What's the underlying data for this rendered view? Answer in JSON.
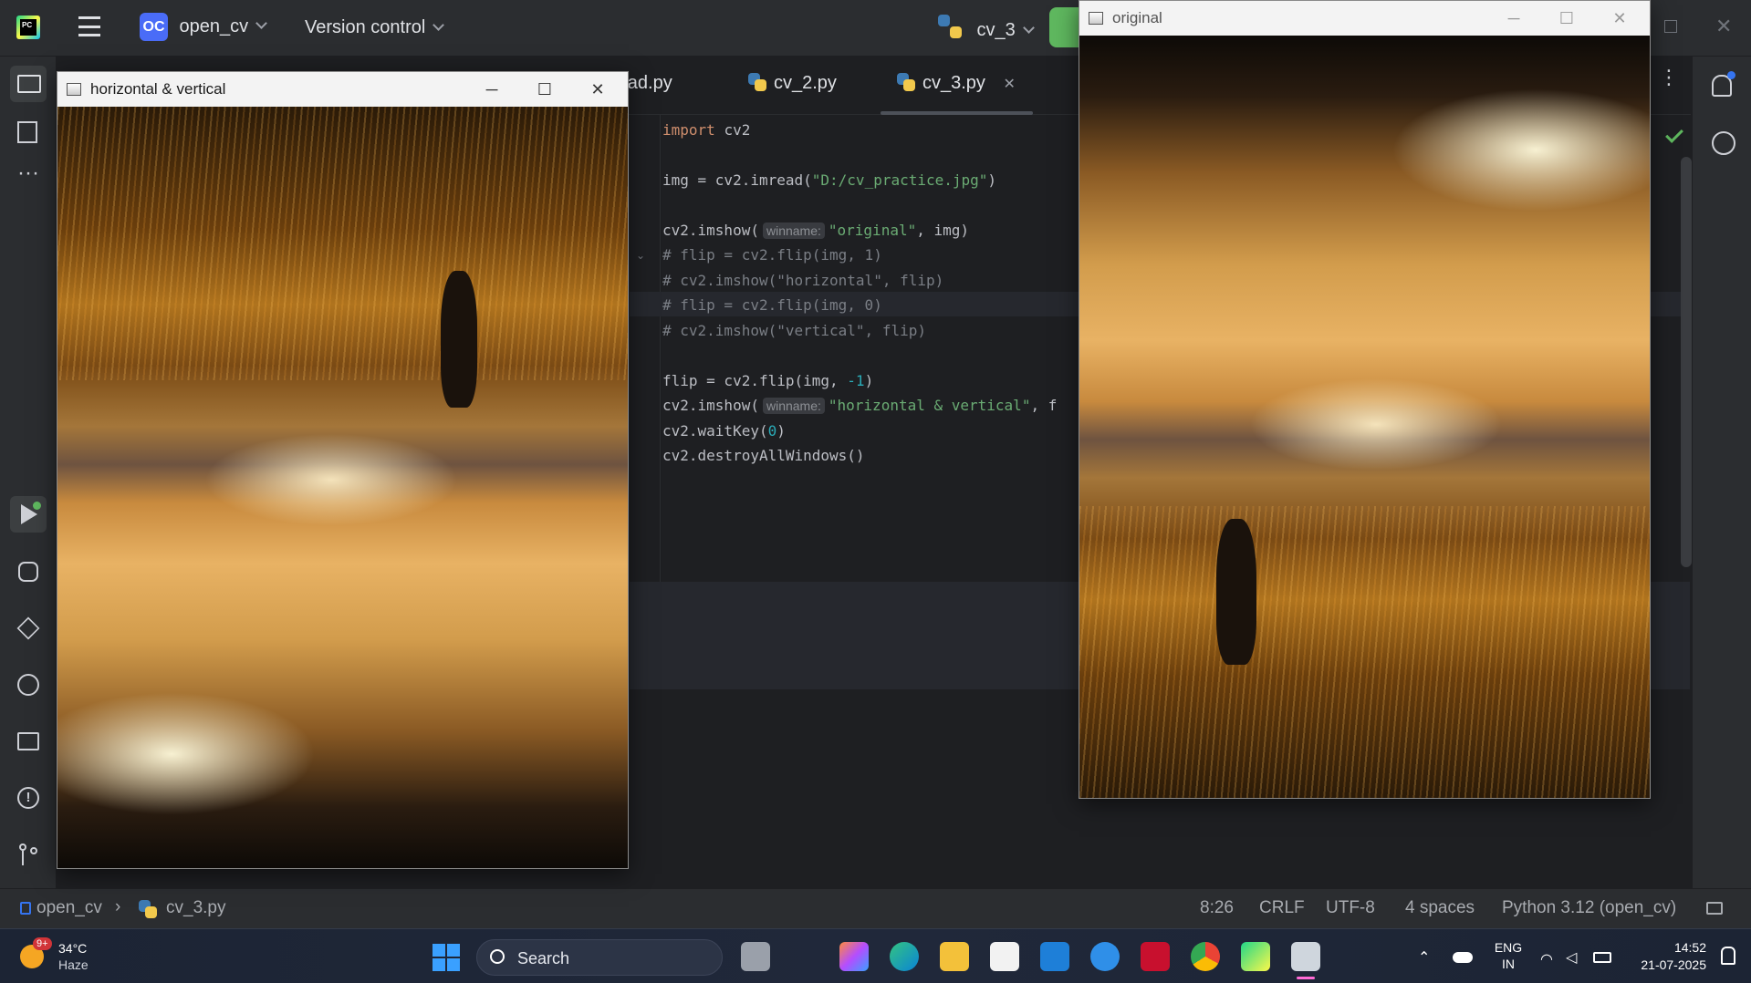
{
  "ide": {
    "project_badge": "OC",
    "project_name": "open_cv",
    "vcs": "Version control",
    "run_config": "cv_3",
    "tabs": [
      {
        "label": "read.py"
      },
      {
        "label": "cv_2.py"
      },
      {
        "label": "cv_3.py"
      }
    ],
    "code_lines": [
      {
        "a": "import cv2"
      },
      {
        "a": "img = cv2.imread(",
        "s": "\"D:/cv_practice.jpg\"",
        "b": ")"
      },
      {
        "a": "cv2.imshow(",
        "hint": "winname:",
        "s": "\"original\"",
        "b": ", img)"
      },
      {
        "c": "# flip = cv2.flip(img, 1)"
      },
      {
        "c": "# cv2.imshow(\"horizontal\", flip)"
      },
      {
        "c": "# flip = cv2.flip(img, 0)"
      },
      {
        "c": "# cv2.imshow(\"vertical\", flip)"
      },
      {
        "a": "flip = cv2.flip(img, ",
        "n": "-1",
        "b": ")"
      },
      {
        "a": "cv2.imshow(",
        "hint": "winname:",
        "s": "\"horizontal & vertical\"",
        "b": ", f"
      },
      {
        "a": "cv2.waitKey(",
        "n": "0",
        "b": ")"
      },
      {
        "a": "cv2.destroyAllWindows()"
      }
    ]
  },
  "windows": {
    "flipped_title": "horizontal & vertical",
    "original_title": "original"
  },
  "status": {
    "breadcrumb_project": "open_cv",
    "breadcrumb_file": "cv_3.py",
    "position": "8:26",
    "line_sep": "CRLF",
    "encoding": "UTF-8",
    "indent": "4 spaces",
    "interpreter": "Python 3.12 (open_cv)"
  },
  "taskbar": {
    "weather_badge": "9+",
    "temp": "34°C",
    "condition": "Haze",
    "search": "Search",
    "lang1": "ENG",
    "lang2": "IN",
    "time": "14:52",
    "date": "21-07-2025"
  },
  "colors": {
    "accent": "#3574f0",
    "project_badge": "#4a6cf7",
    "run_button": "#5fb85f"
  }
}
